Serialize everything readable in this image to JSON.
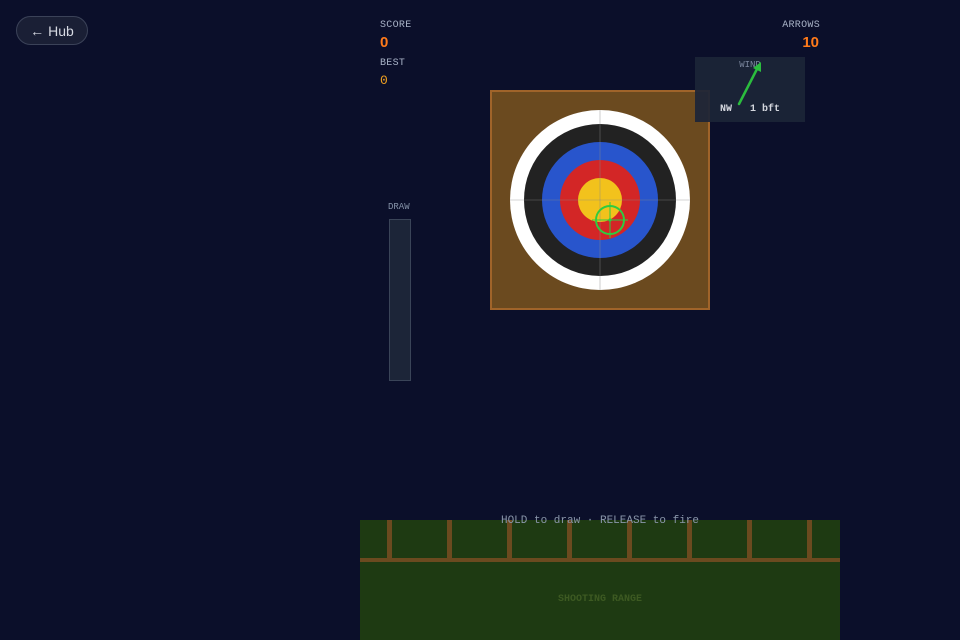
{
  "nav": {
    "back_arrow": "←",
    "back_label": "Hub"
  },
  "hud": {
    "score_label": "SCORE",
    "score_value": "0",
    "best_label": "BEST",
    "best_value": "0",
    "arrows_label": "ARROWS",
    "arrows_value": "10"
  },
  "wind": {
    "title": "WIND",
    "direction": "NW",
    "strength": "1 bft",
    "arrow_color": "#2ecc40"
  },
  "draw": {
    "label": "DRAW",
    "level": 0
  },
  "hint": "HOLD to draw · RELEASE to fire",
  "range": {
    "label": "SHOOTING RANGE"
  },
  "target": {
    "rings": [
      "white",
      "black",
      "blue",
      "red",
      "gold"
    ],
    "reticle_color": "#2ecc40"
  },
  "colors": {
    "background": "#0b0f2a",
    "accent": "#ff7a1a",
    "grass": "#1e3a12",
    "board": "#6b4a1f",
    "fence": "#6b4a1f"
  }
}
